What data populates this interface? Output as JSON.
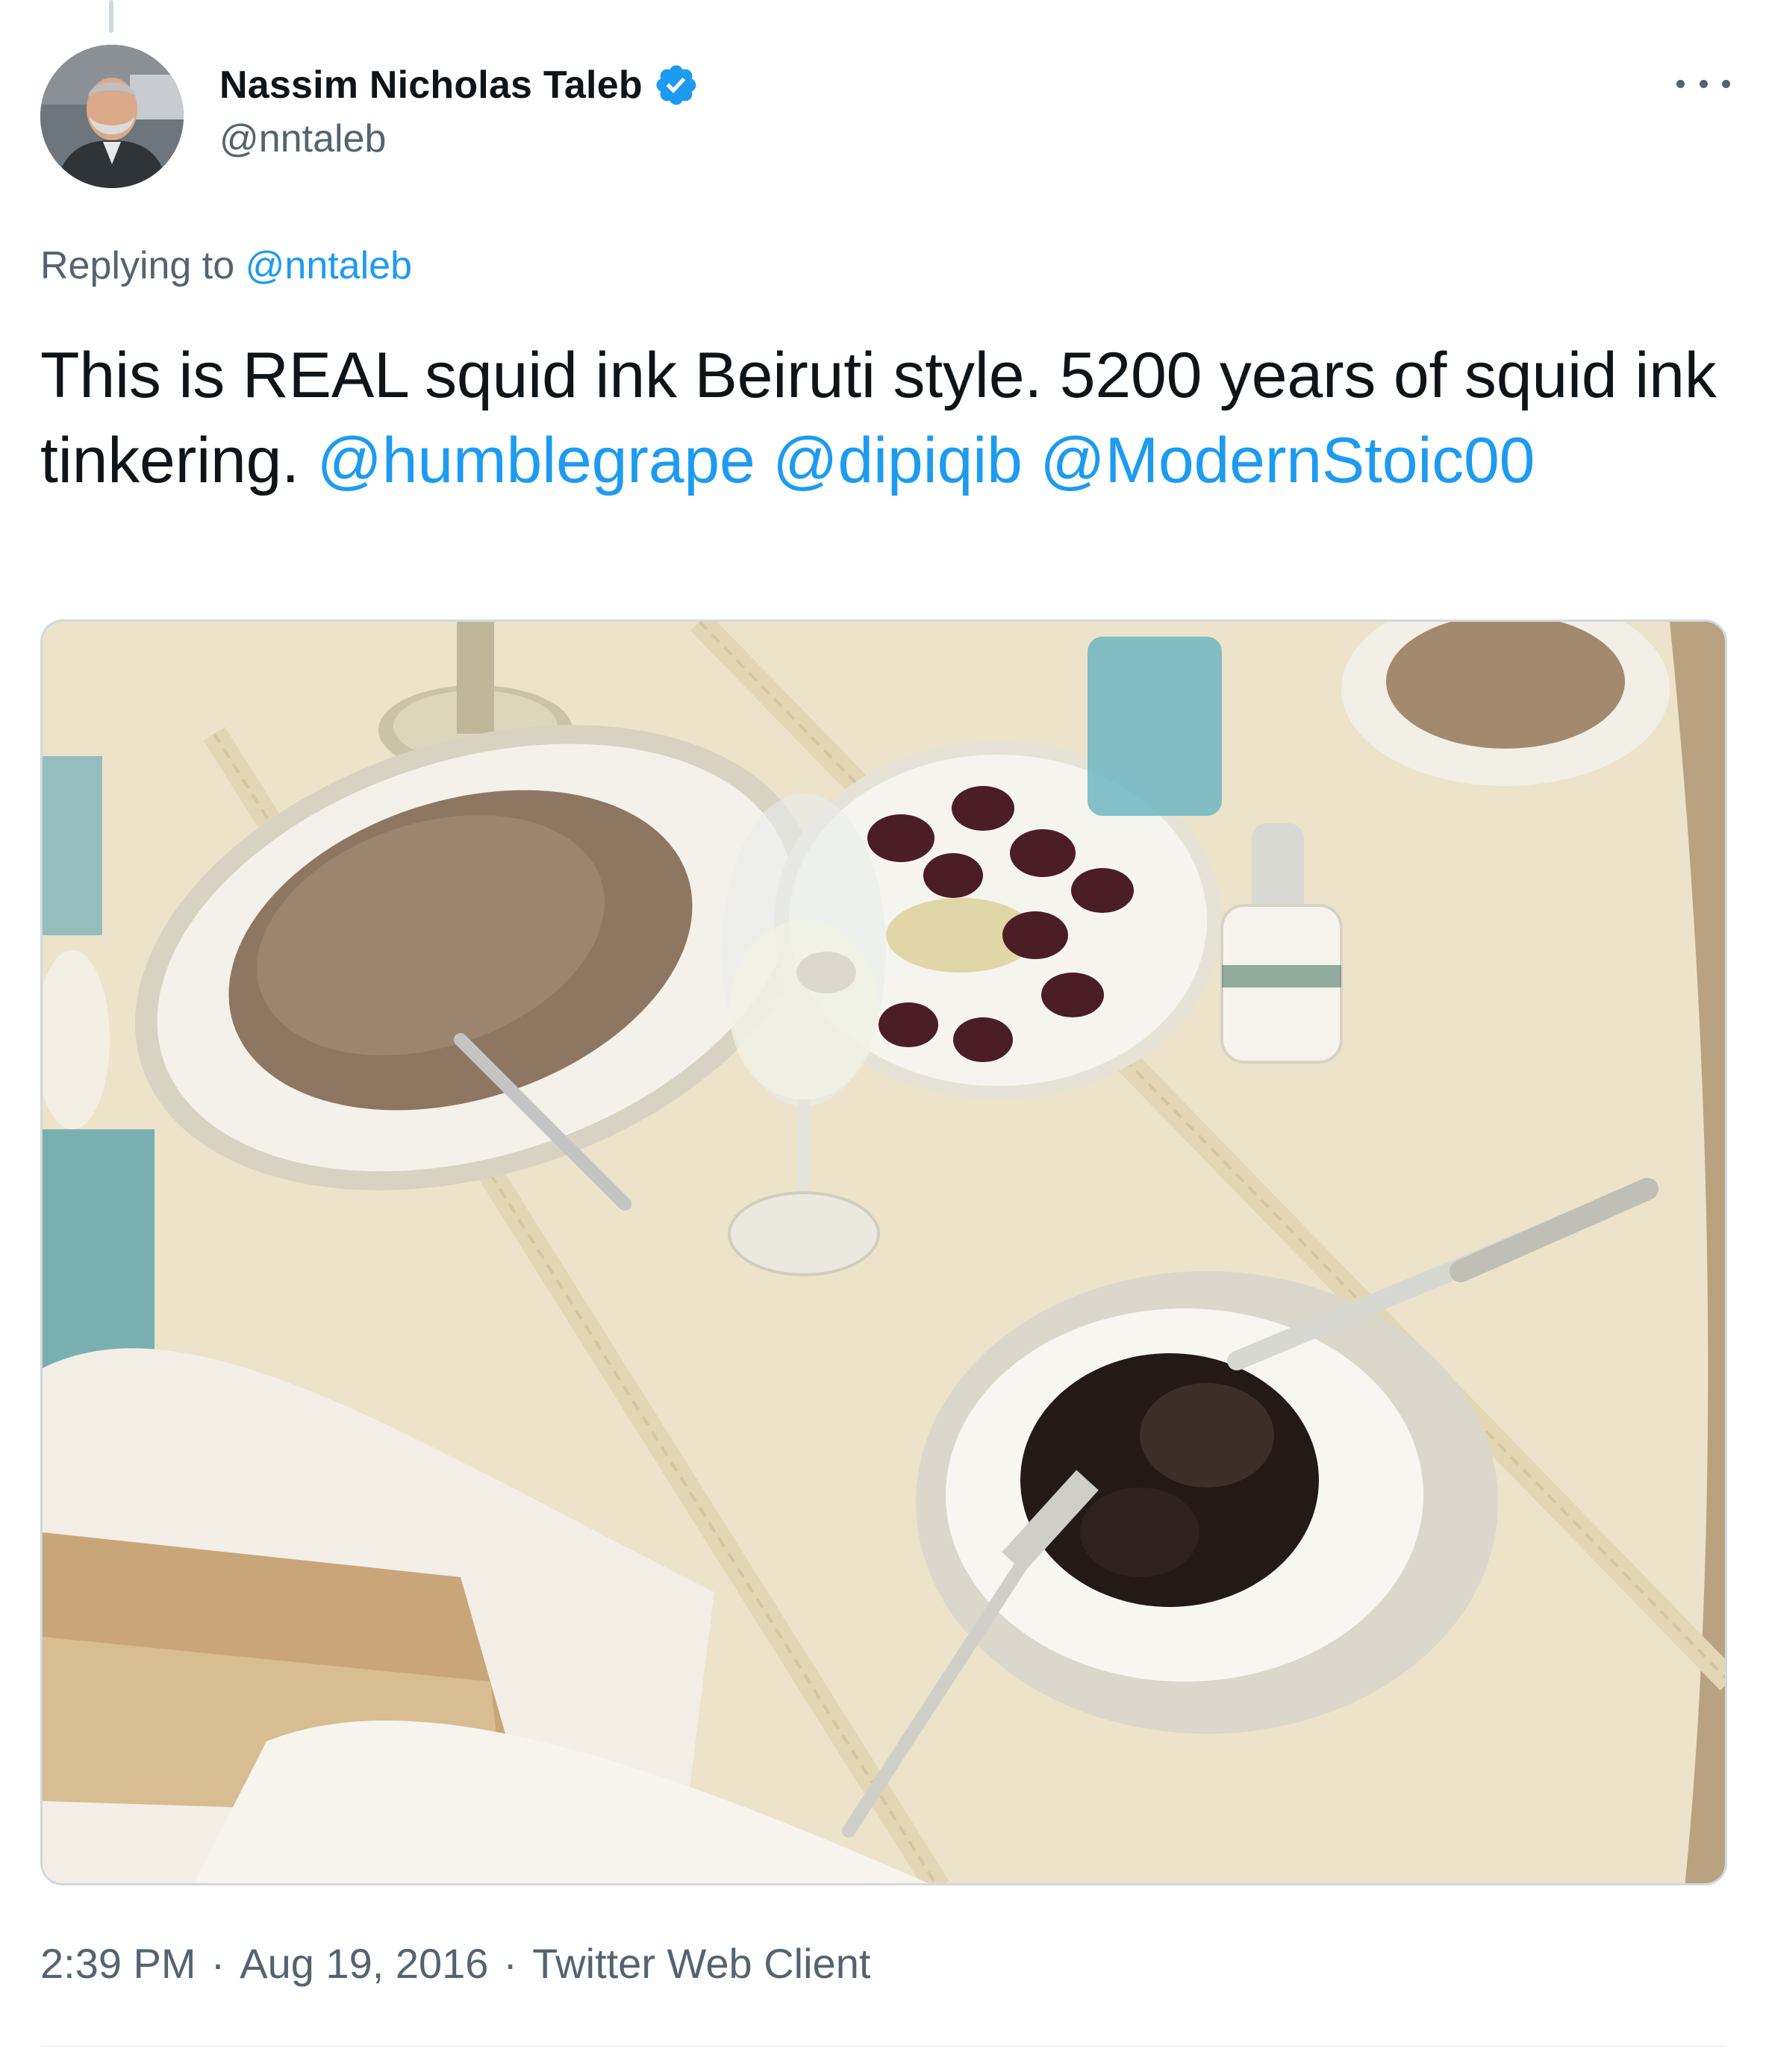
{
  "tweet": {
    "author": {
      "display_name": "Nassim Nicholas Taleb",
      "handle": "@nntaleb",
      "verified": true,
      "avatar_icon": "profile-photo"
    },
    "replying_to": {
      "prefix": "Replying to",
      "handle": "@nntaleb"
    },
    "text": {
      "body": "This is REAL squid ink Beiruti style. 5200 years of squid ink tinkering.",
      "mentions": [
        "@humblegrape",
        "@dipiqib",
        "@ModernStoic00"
      ]
    },
    "timestamp": {
      "time": "2:39 PM",
      "date": "Aug 19, 2016",
      "client": "Twitter Web Client",
      "separator": "·"
    },
    "more_icon": "ellipsis-icon"
  },
  "colors": {
    "link": "#1d9bf0",
    "secondary_text": "#536471",
    "primary_text": "#0f1419",
    "verified_badge": "#1d9bf0",
    "border": "#cfd9de"
  }
}
